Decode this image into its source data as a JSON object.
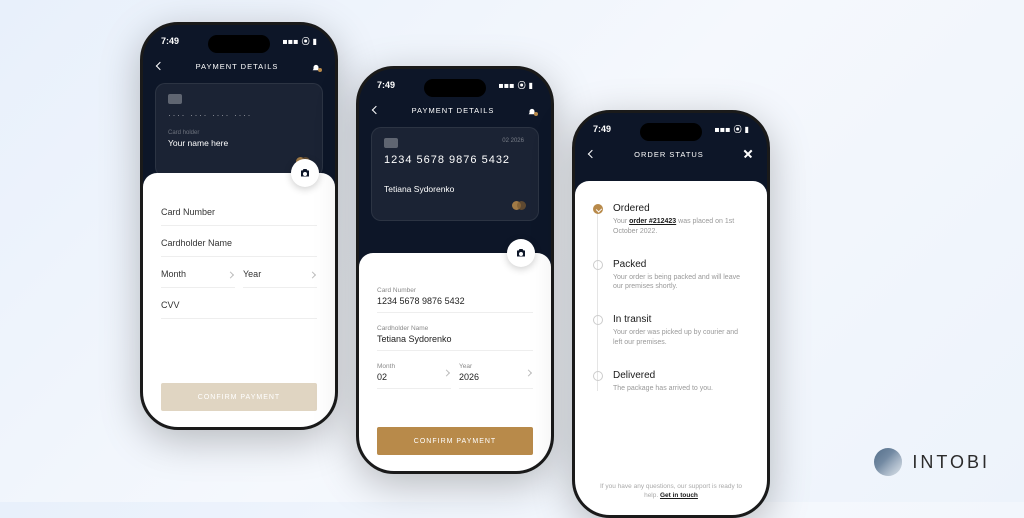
{
  "status_time": "7:49",
  "brand": {
    "name": "INTOBI"
  },
  "phone1": {
    "header_title": "PAYMENT DETAILS",
    "card": {
      "number_placeholder": "···· ···· ···· ····",
      "holder_label": "Card holder",
      "holder_placeholder": "Your name here"
    },
    "fields": {
      "card_number_label": "Card Number",
      "cardholder_label": "Cardholder Name",
      "month_label": "Month",
      "year_label": "Year",
      "cvv_label": "CVV"
    },
    "confirm_label": "CONFIRM PAYMENT"
  },
  "phone2": {
    "header_title": "PAYMENT DETAILS",
    "card": {
      "expiry_hint": "02  2026",
      "number": "1234 5678 9876 5432",
      "holder": "Tetiana Sydorenko"
    },
    "fields": {
      "card_number_label": "Card Number",
      "card_number_value": "1234 5678 9876 5432",
      "cardholder_label": "Cardholder Name",
      "cardholder_value": "Tetiana Sydorenko",
      "month_label": "Month",
      "month_value": "02",
      "year_label": "Year",
      "year_value": "2026"
    },
    "confirm_label": "CONFIRM PAYMENT"
  },
  "phone3": {
    "header_title": "ORDER STATUS",
    "steps": [
      {
        "title": "Ordered",
        "desc_pre": "Your ",
        "desc_link": "order #212423",
        "desc_post": " was placed on 1st October 2022.",
        "done": true
      },
      {
        "title": "Packed",
        "desc": "Your order is being packed and will leave our premises shortly."
      },
      {
        "title": "In transit",
        "desc": "Your order was picked up by courier and left our premises."
      },
      {
        "title": "Delivered",
        "desc": "The package has arrived to you."
      }
    ],
    "help_pre": "If you have any questions, our support is ready to help. ",
    "help_link": "Get in touch"
  }
}
